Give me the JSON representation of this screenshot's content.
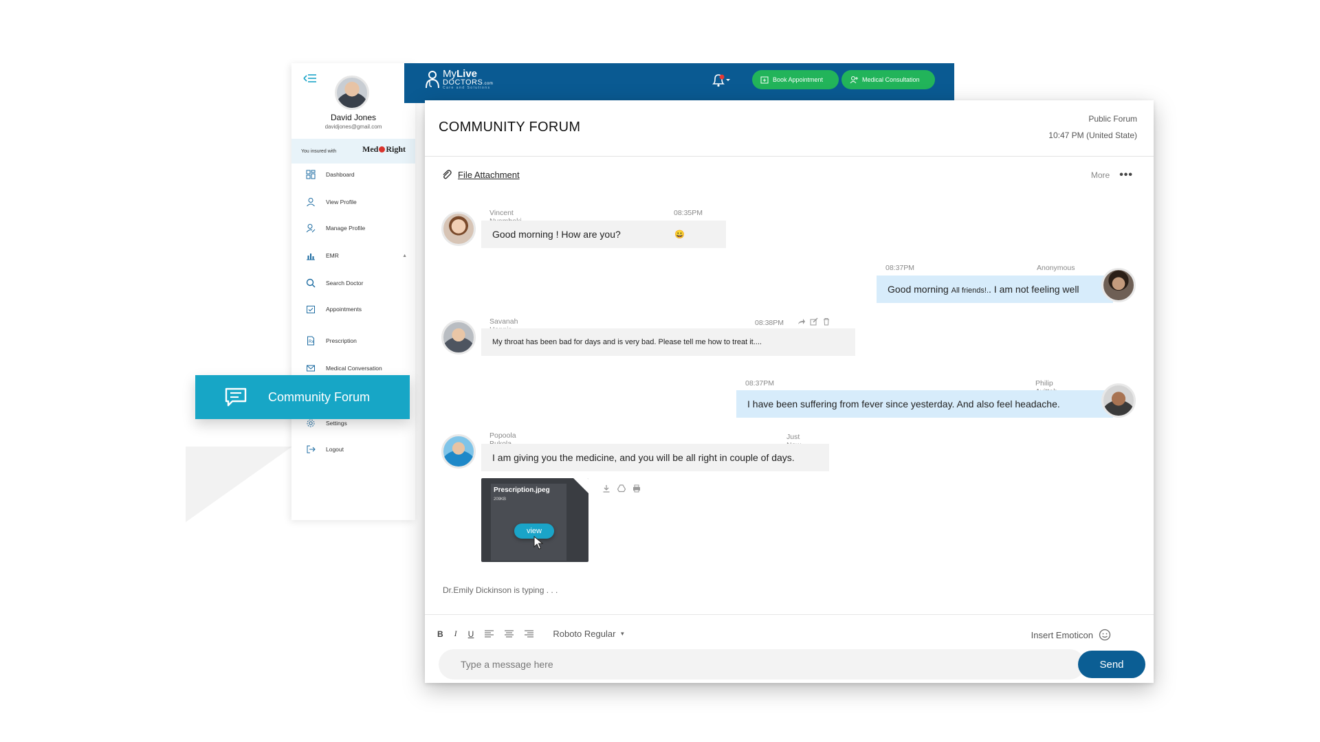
{
  "user": {
    "name": "David Jones",
    "email": "davidjones@gmail.com"
  },
  "insurance": {
    "label": "You insured with",
    "provider_left": "Med",
    "provider_right": "Right"
  },
  "sidebar": {
    "items": [
      {
        "label": "Dashboard",
        "icon": "dashboard-icon"
      },
      {
        "label": "View Profile",
        "icon": "user-icon"
      },
      {
        "label": "Manage Profile",
        "icon": "user-edit-icon"
      },
      {
        "label": "EMR",
        "icon": "bar-chart-icon"
      },
      {
        "label": "Search Doctor",
        "icon": "search-icon"
      },
      {
        "label": "Appointments",
        "icon": "calendar-check-icon"
      },
      {
        "label": "Prescription",
        "icon": "prescription-icon"
      },
      {
        "label": "Medical Conversation",
        "icon": "mail-icon"
      },
      {
        "label": "Community Forum",
        "icon": "chat-icon"
      },
      {
        "label": "Settings",
        "icon": "gear-icon"
      },
      {
        "label": "Logout",
        "icon": "logout-icon"
      }
    ],
    "active": "Community Forum"
  },
  "header": {
    "brand_my": "My",
    "brand_live": "Live",
    "brand_doctors": "DOCTORS",
    "brand_com": ".com",
    "brand_tagline": "Care and Solutions",
    "book_label": "Book Appointment",
    "consult_label": "Medical Consultation"
  },
  "forum": {
    "title": "COMMUNITY FORUM",
    "type": "Public Forum",
    "time": "10:47 PM  (United State)",
    "attachment_label": "File Attachment",
    "more_label": "More"
  },
  "messages": [
    {
      "name": "Vincent Nyamboki",
      "time": "08:35PM",
      "text": "Good morning !  How are you?",
      "emoji": "😀"
    },
    {
      "name": "Anonymous",
      "time": "08:37PM",
      "text_a": "Good morning ",
      "text_small": "All friends!.",
      "text_b": ". I am not feeling well"
    },
    {
      "name": "Savanah Hennis",
      "time": "08:38PM",
      "text": "My throat has been bad for days and is very bad. Please tell me how to treat it...."
    },
    {
      "name": "Philip Ayittah",
      "time": "08:37PM",
      "text": "I have been suffering from fever since yesterday. And also feel headache."
    },
    {
      "name": "Popoola Bukola",
      "time": "Just Now",
      "text": "I am giving you the medicine, and you will be all right in couple of days."
    }
  ],
  "attachment": {
    "file_name": "Prescription.jpeg",
    "file_size": "209KB",
    "view_label": "view"
  },
  "typing": "Dr.Emily Dickinson is typing . . .",
  "composer": {
    "bold": "B",
    "italic": "I",
    "underline": "U",
    "font": "Roboto Regular",
    "emoticon_label": "Insert Emoticon",
    "placeholder": "Type a message here",
    "send_label": "Send"
  },
  "colors": {
    "primary": "#0a5a92",
    "accent": "#17a6c6",
    "green": "#22b45a",
    "bubble_out": "#d7ecfb",
    "bubble_in": "#f2f2f2"
  }
}
